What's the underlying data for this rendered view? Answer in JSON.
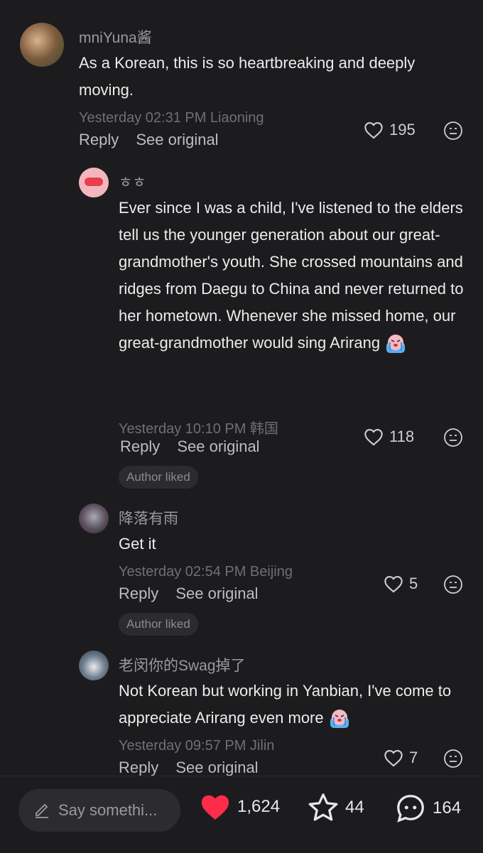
{
  "comments": [
    {
      "username": "mniYuna酱",
      "text": "As a Korean, this is so heartbreaking and deeply moving.",
      "meta": "Yesterday 02:31 PM Liaoning",
      "reply_label": "Reply",
      "see_original_label": "See original",
      "likes": "195"
    },
    {
      "username": "ㅎㅎ",
      "text": "Ever since I was a child, I've listened to the elders tell us the younger generation about our great-grandmother's youth. She crossed mountains and ridges from Daegu to China and never returned to her hometown. Whenever she missed home, our great-grandmother would sing Arirang",
      "meta": "Yesterday 10:10 PM 韩国",
      "reply_label": "Reply",
      "see_original_label": "See original",
      "likes": "118",
      "badge": "Author liked"
    },
    {
      "username": "降落有雨",
      "text": "Get it",
      "meta": "Yesterday 02:54 PM Beijing",
      "reply_label": "Reply",
      "see_original_label": "See original",
      "likes": "5",
      "badge": "Author liked"
    },
    {
      "username": "老闵你的Swag掉了",
      "text": "Not Korean but working in Yanbian, I've come to appreciate Arirang even more",
      "meta": "Yesterday 09:57 PM Jilin",
      "reply_label": "Reply",
      "see_original_label": "See original",
      "likes": "7"
    }
  ],
  "bottom_bar": {
    "input_placeholder": "Say somethi...",
    "likes": "1,624",
    "favorites": "44",
    "comments": "164"
  },
  "colors": {
    "background": "#1c1c1e",
    "heart_active": "#ff2b4a"
  },
  "icons": [
    "heart-outline-icon",
    "neutral-face-icon",
    "pencil-icon",
    "heart-filled-icon",
    "star-icon",
    "chat-bubble-icon",
    "crying-emoji"
  ]
}
